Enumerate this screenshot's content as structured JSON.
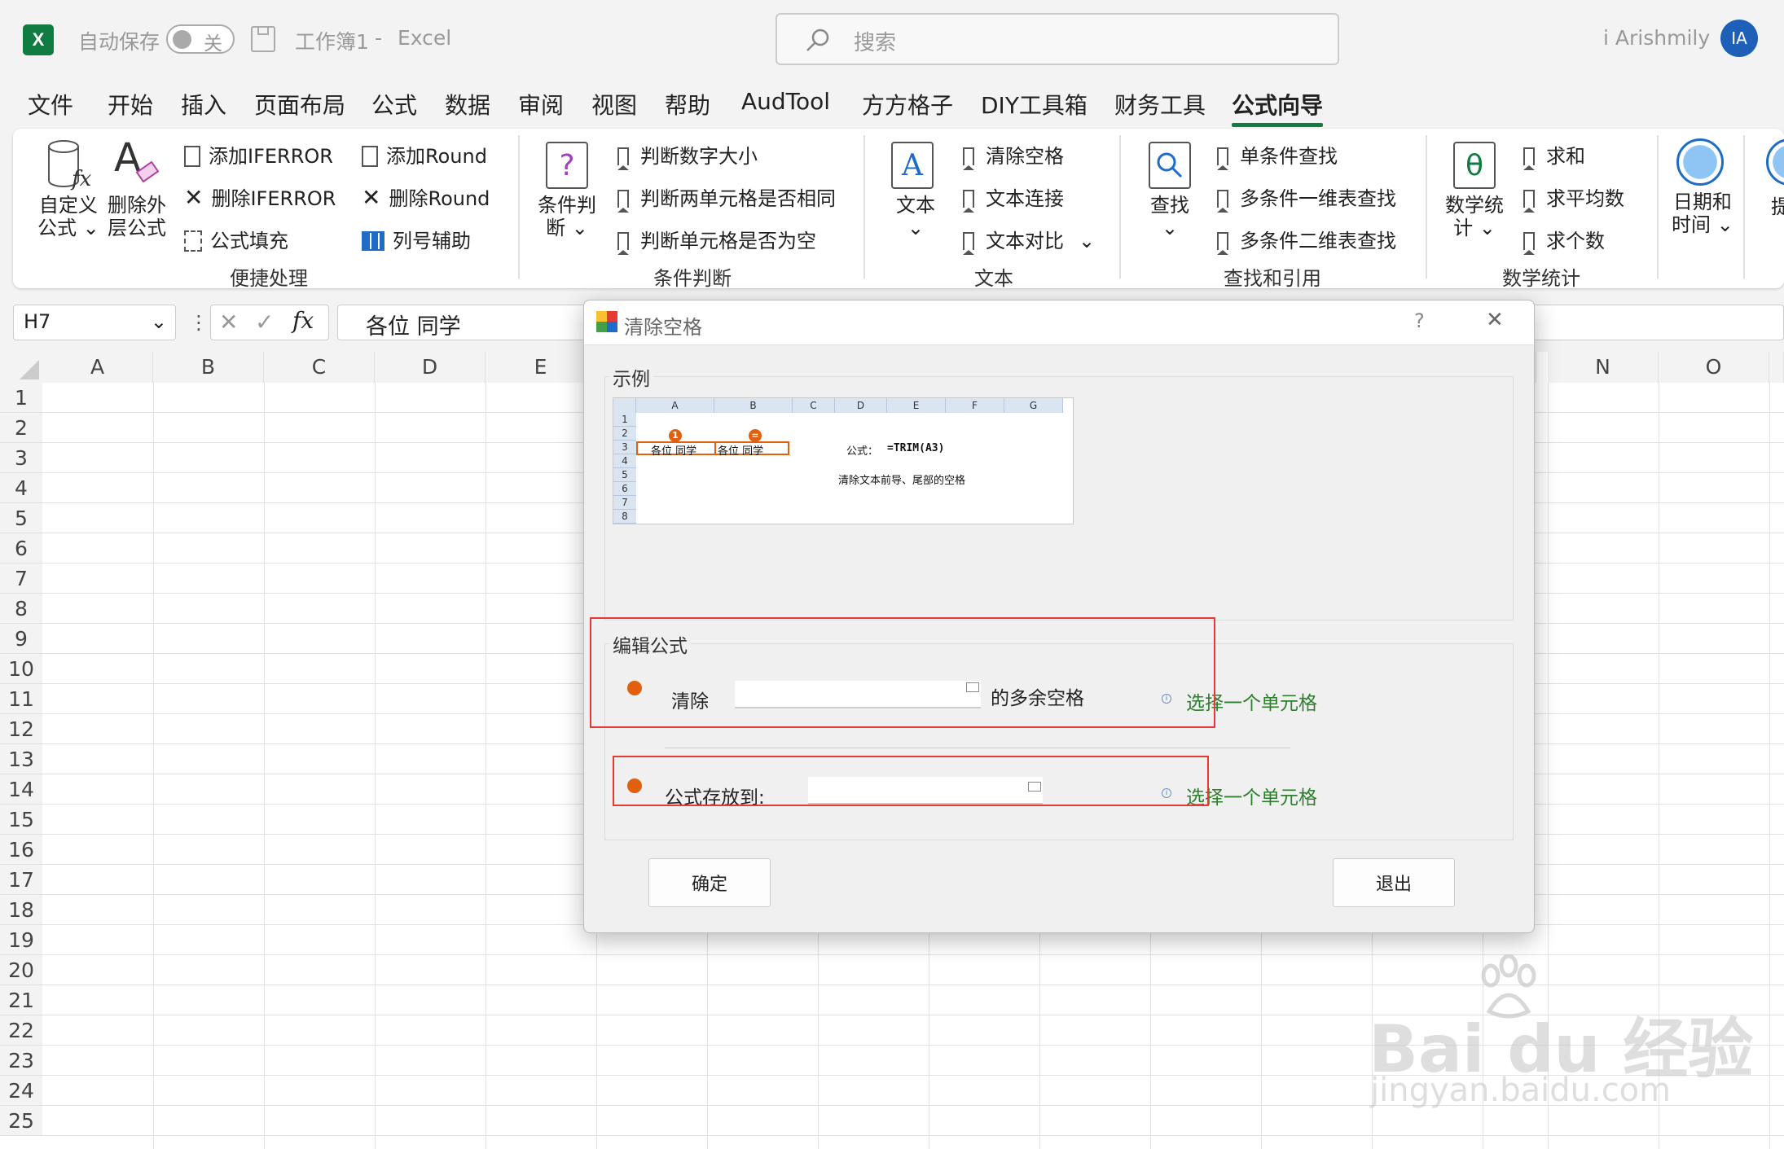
{
  "titlebar": {
    "autosave_label": "自动保存",
    "autosave_state": "关",
    "doc_title": "工作簿1",
    "sep": "-",
    "app_name": "Excel",
    "search_placeholder": "搜索",
    "user_name": "i Arishmily",
    "avatar_initials": "IA"
  },
  "menu": {
    "items": [
      "文件",
      "开始",
      "插入",
      "页面布局",
      "公式",
      "数据",
      "审阅",
      "视图",
      "帮助",
      "AudTool",
      "方方格子",
      "DIY工具箱",
      "财务工具",
      "公式向导"
    ],
    "active": "公式向导"
  },
  "ribbon": {
    "group1": {
      "big1_line1": "自定义",
      "big1_line2": "公式",
      "big2_line1": "删除外",
      "big2_line2": "层公式",
      "add_iferror": "添加IFERROR",
      "del_iferror": "删除IFERROR",
      "fill_formula": "公式填充",
      "add_round": "添加Round",
      "del_round": "删除Round",
      "col_helper": "列号辅助",
      "name": "便捷处理"
    },
    "group2": {
      "big_line1": "条件判",
      "big_line2": "断",
      "item1": "判断数字大小",
      "item2": "判断两单元格是否相同",
      "item3": "判断单元格是否为空",
      "name": "条件判断"
    },
    "group3": {
      "big_label": "文本",
      "item1": "清除空格",
      "item2": "文本连接",
      "item3": "文本对比",
      "name": "文本"
    },
    "group4": {
      "big_label": "查找",
      "item1": "单条件查找",
      "item2": "多条件一维表查找",
      "item3": "多条件二维表查找",
      "name": "查找和引用"
    },
    "group5": {
      "big_line1": "数学统",
      "big_line2": "计",
      "item1": "求和",
      "item2": "求平均数",
      "item3": "求个数",
      "name": "数学统计"
    },
    "group6": {
      "big_line1": "日期和",
      "big_line2": "时间",
      "partial": "提"
    }
  },
  "formula_bar": {
    "name_box": "H7",
    "fx": "fx",
    "content": "各位  同学"
  },
  "grid": {
    "columns": [
      "A",
      "B",
      "C",
      "D",
      "E",
      "N",
      "O"
    ],
    "rows": [
      "1",
      "2",
      "3",
      "4",
      "5",
      "6",
      "7",
      "8",
      "9",
      "10",
      "11",
      "12",
      "13",
      "14",
      "15",
      "16",
      "17",
      "18",
      "19",
      "20",
      "21",
      "22",
      "23",
      "24",
      "25"
    ]
  },
  "dialog": {
    "title": "清除空格",
    "help": "?",
    "close": "✕",
    "example_legend": "示例",
    "example": {
      "cols": [
        "A",
        "B",
        "C",
        "D",
        "E",
        "F",
        "G"
      ],
      "rows": [
        "1",
        "2",
        "3",
        "4",
        "5",
        "6",
        "7",
        "8"
      ],
      "badge1": "1",
      "badge2": "=",
      "a3": "各位   同学",
      "b3": "各位  同学",
      "formula_label": "公式：",
      "formula_value": "=TRIM(A3)",
      "note": "清除文本前导、尾部的空格"
    },
    "edit_legend": "编辑公式",
    "clear_label": "清除",
    "clear_suffix": "的多余空格",
    "clear_input": "",
    "hint1": "选择一个单元格",
    "store_label": "公式存放到:",
    "store_input": "",
    "hint2": "选择一个单元格",
    "ok_button": "确定",
    "exit_button": "退出"
  },
  "watermark": {
    "brand": "Bai du 经验",
    "url": "jingyan.baidu.com"
  }
}
